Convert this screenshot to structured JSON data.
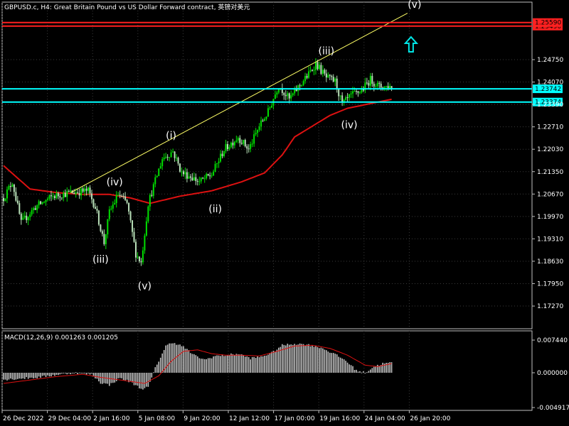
{
  "header": {
    "title": "GBPUSD.c, H4:  Great Britain Pound vs US Dollar Forward contract, 英镑对美元"
  },
  "colors": {
    "background": "#000000",
    "grid": "#3a3a3a",
    "bull": "#00e000",
    "bear": "#b8e0b8",
    "ma": "#dd1111",
    "trendline": "#ffff66",
    "hline_red": "#ff2020",
    "hline_cyan": "#00ffff",
    "arrow": "#00e5e5",
    "macd_hist": "#c0c0c0",
    "macd_signal": "#dd1111"
  },
  "chart_data": [
    {
      "type": "candlestick",
      "title": "GBPUSD.c, H4:  Great Britain Pound vs US Dollar Forward contract, 英镑对美元",
      "ylim": [
        1.17,
        1.27
      ],
      "price_labels": [
        "1.24750",
        "1.24070",
        "1.23390",
        "1.22710",
        "1.22030",
        "1.21350",
        "1.20670",
        "1.19970",
        "1.19310",
        "1.18630",
        "1.17950",
        "1.17270"
      ],
      "x_tick_labels": [
        "26 Dec 2022",
        "29 Dec 04:00",
        "2 Jan 16:00",
        "5 Jan 08:00",
        "9 Jan 20:00",
        "12 Jan 12:00",
        "17 Jan 00:00",
        "19 Jan 16:00",
        "24 Jan 04:00",
        "26 Jan 20:00"
      ],
      "price_path_anchors": [
        [
          0,
          1.207
        ],
        [
          5,
          1.2115
        ],
        [
          10,
          1.2
        ],
        [
          18,
          1.2045
        ],
        [
          28,
          1.2075
        ],
        [
          38,
          1.2085
        ],
        [
          48,
          1.209
        ],
        [
          52,
          1.2045
        ],
        [
          57,
          1.1945
        ],
        [
          60,
          1.203
        ],
        [
          65,
          1.208
        ],
        [
          70,
          1.2055
        ],
        [
          75,
          1.1915
        ],
        [
          78,
          1.189
        ],
        [
          82,
          1.2055
        ],
        [
          90,
          1.218
        ],
        [
          96,
          1.22
        ],
        [
          101,
          1.214
        ],
        [
          106,
          1.213
        ],
        [
          111,
          1.2115
        ],
        [
          118,
          1.2135
        ],
        [
          125,
          1.2205
        ],
        [
          133,
          1.224
        ],
        [
          139,
          1.2205
        ],
        [
          145,
          1.227
        ],
        [
          150,
          1.231
        ],
        [
          156,
          1.2385
        ],
        [
          162,
          1.2345
        ],
        [
          168,
          1.2385
        ],
        [
          173,
          1.2415
        ],
        [
          177,
          1.2445
        ],
        [
          183,
          1.2405
        ],
        [
          188,
          1.2395
        ],
        [
          192,
          1.233
        ],
        [
          197,
          1.2355
        ],
        [
          203,
          1.237
        ],
        [
          208,
          1.24
        ],
        [
          213,
          1.238
        ],
        [
          220,
          1.238
        ]
      ],
      "moving_average_anchors": [
        [
          0,
          1.216
        ],
        [
          15,
          1.2095
        ],
        [
          30,
          1.2085
        ],
        [
          45,
          1.208
        ],
        [
          60,
          1.208
        ],
        [
          72,
          1.207
        ],
        [
          83,
          1.2055
        ],
        [
          100,
          1.2075
        ],
        [
          118,
          1.209
        ],
        [
          135,
          1.2115
        ],
        [
          148,
          1.214
        ],
        [
          158,
          1.219
        ],
        [
          165,
          1.224
        ],
        [
          175,
          1.227
        ],
        [
          185,
          1.23
        ],
        [
          195,
          1.232
        ],
        [
          205,
          1.233
        ],
        [
          220,
          1.2345
        ]
      ],
      "trend_line": {
        "from": [
          38,
          1.2085
        ],
        "to": [
          229,
          1.2585
        ]
      },
      "horizontal_lines": [
        {
          "price": 1.2549,
          "label": "1.25490",
          "color": "red"
        },
        {
          "price": 1.2559,
          "label": "1.25590",
          "color": "red"
        },
        {
          "price": 1.23742,
          "label": "1.23742",
          "color": "cyan"
        },
        {
          "price": 1.23374,
          "label": "1.23374",
          "color": "cyan"
        }
      ],
      "wave_labels": [
        {
          "text": "(iv)",
          "x": 63,
          "price": 1.2105
        },
        {
          "text": "(iii)",
          "x": 55,
          "price": 1.189
        },
        {
          "text": "(v)",
          "x": 80,
          "price": 1.1815
        },
        {
          "text": "(i)",
          "x": 95,
          "price": 1.2235
        },
        {
          "text": "(ii)",
          "x": 120,
          "price": 1.203
        },
        {
          "text": "(iii)",
          "x": 183,
          "price": 1.247
        },
        {
          "text": "(iv)",
          "x": 196,
          "price": 1.2265
        },
        {
          "text": "(v)",
          "x": 233,
          "price": 1.26
        }
      ],
      "arrow": {
        "direction": "up",
        "x": 231,
        "price": 1.2495
      }
    },
    {
      "type": "macd",
      "title": "MACD(12,26,9) 0.001263 0.001205",
      "ylim": [
        -0.005,
        0.005
      ],
      "price_labels": [
        "0.007440",
        "0.000000",
        "-0.004917"
      ],
      "hist_anchors": [
        [
          0,
          -0.0009
        ],
        [
          20,
          -0.0006
        ],
        [
          32,
          -0.0002
        ],
        [
          40,
          0.0
        ],
        [
          50,
          -0.0002
        ],
        [
          55,
          -0.0013
        ],
        [
          60,
          -0.0016
        ],
        [
          66,
          -0.0007
        ],
        [
          72,
          -0.0012
        ],
        [
          78,
          -0.0021
        ],
        [
          82,
          -0.0019
        ],
        [
          86,
          0.0006
        ],
        [
          92,
          0.0035
        ],
        [
          96,
          0.004
        ],
        [
          102,
          0.0034
        ],
        [
          108,
          0.0023
        ],
        [
          114,
          0.0017
        ],
        [
          120,
          0.0022
        ],
        [
          126,
          0.0023
        ],
        [
          133,
          0.0025
        ],
        [
          140,
          0.0019
        ],
        [
          146,
          0.0021
        ],
        [
          152,
          0.0026
        ],
        [
          158,
          0.0036
        ],
        [
          165,
          0.0038
        ],
        [
          172,
          0.0037
        ],
        [
          180,
          0.0033
        ],
        [
          188,
          0.0024
        ],
        [
          194,
          0.0016
        ],
        [
          200,
          0.0003
        ],
        [
          205,
          0.0
        ],
        [
          210,
          0.0008
        ],
        [
          215,
          0.0012
        ],
        [
          220,
          0.0013
        ]
      ],
      "signal_anchors": [
        [
          0,
          -0.0014
        ],
        [
          30,
          -0.0005
        ],
        [
          45,
          -0.0002
        ],
        [
          55,
          -0.0006
        ],
        [
          68,
          -0.001
        ],
        [
          80,
          -0.0014
        ],
        [
          88,
          -0.0004
        ],
        [
          95,
          0.0015
        ],
        [
          102,
          0.0028
        ],
        [
          110,
          0.003
        ],
        [
          118,
          0.0025
        ],
        [
          126,
          0.0023
        ],
        [
          135,
          0.0023
        ],
        [
          145,
          0.0022
        ],
        [
          155,
          0.0028
        ],
        [
          165,
          0.0035
        ],
        [
          175,
          0.0036
        ],
        [
          185,
          0.0032
        ],
        [
          195,
          0.0023
        ],
        [
          205,
          0.001
        ],
        [
          212,
          0.0008
        ],
        [
          220,
          0.0012
        ]
      ]
    }
  ]
}
